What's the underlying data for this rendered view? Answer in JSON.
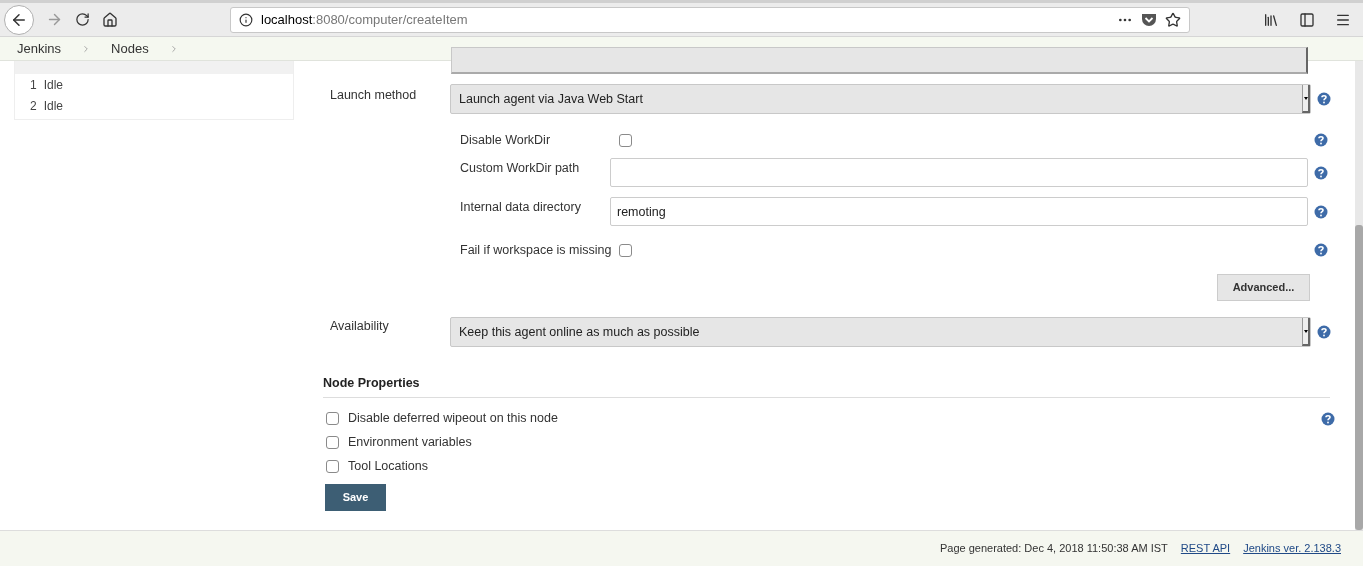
{
  "browser": {
    "url_host": "localhost",
    "url_path": ":8080/computer/createItem"
  },
  "breadcrumbs": [
    "Jenkins",
    "Nodes"
  ],
  "executors": [
    {
      "number": "1",
      "status": "Idle"
    },
    {
      "number": "2",
      "status": "Idle"
    }
  ],
  "launch": {
    "label": "Launch method",
    "value": "Launch agent via Java Web Start"
  },
  "launch_options": [
    {
      "kind": "checkbox",
      "label": "Disable WorkDir",
      "checked": false
    },
    {
      "kind": "text",
      "label": "Custom WorkDir path"
    },
    {
      "kind": "text",
      "label": "Internal data directory",
      "value": "remoting"
    },
    {
      "kind": "checkbox",
      "label": "Fail if workspace is missing",
      "checked": false
    }
  ],
  "advanced_button": "Advanced...",
  "availability": {
    "label": "Availability",
    "value": "Keep this agent online as much as possible"
  },
  "node_properties": {
    "title": "Node Properties",
    "items": [
      {
        "label": "Disable deferred wipeout on this node",
        "checked": false,
        "help": true
      },
      {
        "label": "Environment variables",
        "checked": false,
        "help": false
      },
      {
        "label": "Tool Locations",
        "checked": false,
        "help": false
      }
    ]
  },
  "save_button": "Save",
  "footer": {
    "generated": "Page generated: Dec 4, 2018 11:50:38 AM IST",
    "links": [
      "REST API",
      "Jenkins ver. 2.138.3"
    ]
  }
}
